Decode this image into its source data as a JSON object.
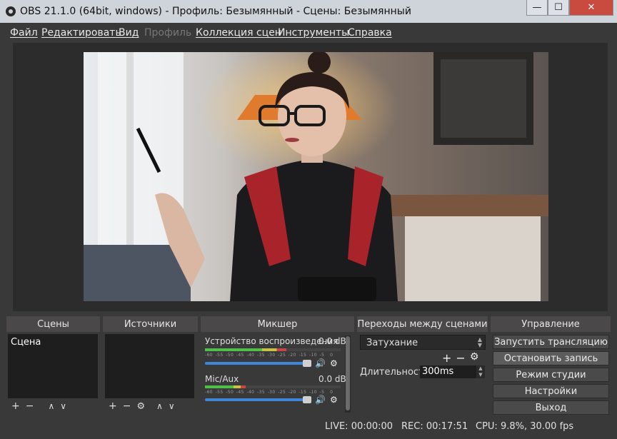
{
  "window": {
    "title": "OBS 21.1.0 (64bit, windows) - Профиль: Безымянный - Сцены: Безымянный",
    "buttons": {
      "minimize": "—",
      "maximize": "☐",
      "close": "✕"
    }
  },
  "menu": {
    "file": "Файл",
    "edit": "Редактировать",
    "view": "Вид",
    "profile": "Профиль",
    "scene_collection": "Коллекция сцен",
    "tools": "Инструменты",
    "help": "Справка"
  },
  "docks": {
    "scenes": {
      "title": "Сцены",
      "items": [
        "Сцена"
      ]
    },
    "sources": {
      "title": "Источники"
    },
    "mixer": {
      "title": "Микшер",
      "channels": [
        {
          "name": "Устройство воспроизведения",
          "db": "0.0 dB",
          "level": 0.6
        },
        {
          "name": "Mic/Aux",
          "db": "0.0 dB",
          "level": 0.3
        }
      ],
      "scale_labels": [
        "-60",
        "-55",
        "-50",
        "-45",
        "-40",
        "-35",
        "-30",
        "-25",
        "-20",
        "-15",
        "-10",
        "-5",
        "0"
      ]
    },
    "transitions": {
      "title": "Переходы между сценами",
      "selected": "Затухание",
      "duration_label": "Длительность",
      "duration_value": "300ms"
    },
    "controls": {
      "title": "Управление",
      "buttons": [
        "Запустить трансляцию",
        "Остановить запись",
        "Режим студии",
        "Настройки",
        "Выход"
      ]
    }
  },
  "status": {
    "live": "LIVE: 00:00:00",
    "rec": "REC: 00:17:51",
    "cpu": "CPU: 9.8%, 30.00 fps"
  },
  "icons": {
    "add": "+",
    "remove": "−",
    "up": "∧",
    "down": "∨",
    "gear": "⚙",
    "speaker": "🔊"
  }
}
